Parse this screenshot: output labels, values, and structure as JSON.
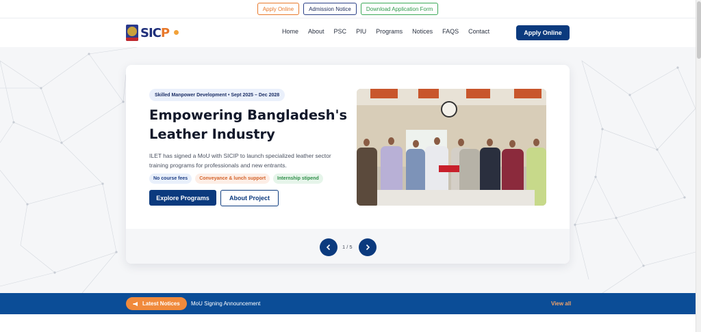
{
  "top_links": {
    "apply_online": "Apply Online",
    "admission_notice": "Admission Notice",
    "download_form": "Download Application Form"
  },
  "header": {
    "logo_text_main": "SIC",
    "logo_text_accent": "P",
    "nav": [
      "Home",
      "About",
      "PSC",
      "PIU",
      "Programs",
      "Notices",
      "FAQS",
      "Contact"
    ],
    "apply_button": "Apply Online"
  },
  "hero": {
    "tag": "Skilled Manpower Development • Sept 2025 – Dec 2028",
    "title": "Empowering Bangladesh's Leather Industry",
    "description": "ILET has signed a MoU with SICIP to launch specialized leather sector training programs for professionals and new entrants.",
    "chips": [
      "No course fees",
      "Conveyance & lunch support",
      "Internship stipend"
    ],
    "explore_button": "Explore Programs",
    "about_button": "About Project",
    "pager": "1 / 5"
  },
  "notices": {
    "badge": "Latest Notices",
    "text": "MoU Signing Announcement",
    "view_all": "View all"
  },
  "colors": {
    "brand_blue": "#0b3a7e",
    "accent_orange": "#f08a3c",
    "notice_bar": "#0b4d97"
  },
  "icons": {
    "megaphone": "megaphone-icon",
    "prev": "chevron-left-icon",
    "next": "chevron-right-icon"
  }
}
